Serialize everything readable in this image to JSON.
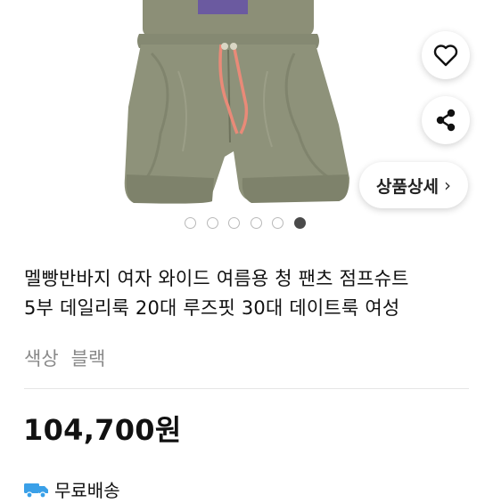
{
  "product": {
    "title_line1": "멜빵반바지 여자 와이드 여름용 청 팬츠 점프슈트",
    "title_line2": "5부 데일리룩 20대 루즈핏 30대 데이트룩 여성",
    "color_label": "색상",
    "color_value": "블랙",
    "price": "104,700원",
    "shipping": "무료배송"
  },
  "image_pager": {
    "total": 6,
    "active_index": 5
  },
  "actions": {
    "like_icon": "heart-outline-icon",
    "share_icon": "share-icon",
    "detail_label": "상품상세",
    "detail_chevron": "›"
  },
  "colors": {
    "fabric": "#8e927a",
    "drawstring": "#e98a78",
    "fab_bg": "#ffffff",
    "pager_active": "#4a4a4a",
    "muted_text": "#8a8a8a"
  }
}
